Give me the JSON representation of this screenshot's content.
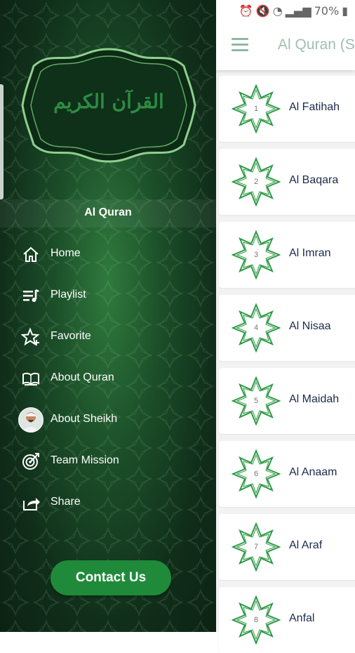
{
  "status_bar": {
    "battery": "70%"
  },
  "header": {
    "title": "Al Quran (S"
  },
  "surahs": [
    {
      "number": "1",
      "name": "Al Fatihah"
    },
    {
      "number": "2",
      "name": "Al Baqara"
    },
    {
      "number": "3",
      "name": "Al Imran"
    },
    {
      "number": "4",
      "name": "Al Nisaa"
    },
    {
      "number": "5",
      "name": "Al Maidah"
    },
    {
      "number": "6",
      "name": "Al Anaam"
    },
    {
      "number": "7",
      "name": "Al Araf"
    },
    {
      "number": "8",
      "name": "Anfal"
    }
  ],
  "drawer": {
    "banner_text": "القرآن الكريم",
    "app_name": "Al Quran",
    "menu": [
      {
        "label": "Home",
        "icon": "home-icon"
      },
      {
        "label": "Playlist",
        "icon": "playlist-icon"
      },
      {
        "label": "Favorite",
        "icon": "favorite-star-icon"
      },
      {
        "label": "About Quran",
        "icon": "quran-book-icon"
      },
      {
        "label": "About Sheikh",
        "icon": "sheikh-avatar"
      },
      {
        "label": "Team Mission",
        "icon": "target-icon"
      },
      {
        "label": "Share",
        "icon": "share-icon"
      }
    ],
    "contact_label": "Contact Us"
  },
  "colors": {
    "accent_green": "#1f8a3a",
    "drawer_dark": "#102e1a",
    "title_muted": "#9fbfb1"
  }
}
